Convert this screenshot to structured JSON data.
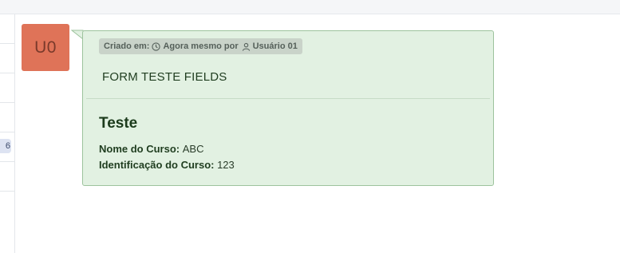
{
  "avatar": {
    "initials": "U0",
    "color": "#df7358"
  },
  "sidebar": {
    "badge": "6"
  },
  "message": {
    "meta": {
      "created_label": "Criado em:",
      "time": "Agora mesmo por",
      "user": "Usuário 01",
      "clock_icon": "clock-icon",
      "user_icon": "user-icon"
    },
    "form_title": "FORM TESTE FIELDS",
    "section_title": "Teste",
    "fields": [
      {
        "label": "Nome do Curso:",
        "value": "ABC"
      },
      {
        "label": "Identificação do Curso:",
        "value": "123"
      }
    ],
    "bubble_color": "#e2f1e2",
    "border_color": "#9dc39d"
  }
}
